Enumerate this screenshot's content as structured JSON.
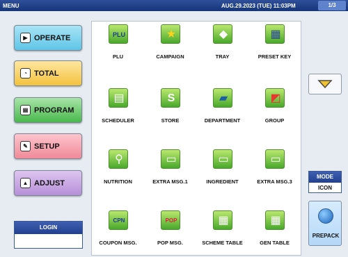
{
  "topbar": {
    "menu": "MENU",
    "datetime": "AUG.29.2023 (TUE) 11:03PM",
    "page": "1/3"
  },
  "nav": {
    "operate": "OPERATE",
    "total": "TOTAL",
    "program": "PROGRAM",
    "setup": "SETUP",
    "adjust": "ADJUST"
  },
  "login": {
    "label": "LOGIN",
    "value": ""
  },
  "grid": [
    {
      "label": "PLU",
      "icon": "plu-icon"
    },
    {
      "label": "CAMPAIGN",
      "icon": "star-icon"
    },
    {
      "label": "TRAY",
      "icon": "tray-icon"
    },
    {
      "label": "PRESET KEY",
      "icon": "preset-key-icon"
    },
    {
      "label": "SCHEDULER",
      "icon": "scheduler-icon"
    },
    {
      "label": "STORE",
      "icon": "store-icon"
    },
    {
      "label": "DEPARTMENT",
      "icon": "folder-icon"
    },
    {
      "label": "GROUP",
      "icon": "group-icon"
    },
    {
      "label": "NUTRITION",
      "icon": "utensils-icon"
    },
    {
      "label": "EXTRA MSG.1",
      "icon": "message-icon"
    },
    {
      "label": "INGREDIENT",
      "icon": "message-icon"
    },
    {
      "label": "EXTRA MSG.3",
      "icon": "message-icon"
    },
    {
      "label": "COUPON MSG.",
      "icon": "coupon-icon"
    },
    {
      "label": "POP MSG.",
      "icon": "pop-icon"
    },
    {
      "label": "SCHEME TABLE",
      "icon": "scheme-table-icon"
    },
    {
      "label": "GEN TABLE",
      "icon": "gen-table-icon"
    }
  ],
  "mode": {
    "label": "MODE",
    "value": "ICON"
  },
  "prepack": {
    "label": "PREPACK"
  }
}
